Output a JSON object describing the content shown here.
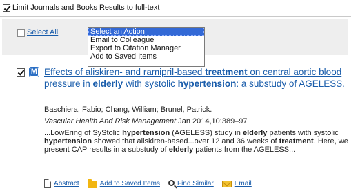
{
  "filters": {
    "limit_fulltext_label": "Limit Journals and Books Results to full-text",
    "limit_fulltext_checked": true
  },
  "toolbar": {
    "select_all_label": "Select All",
    "action_options": [
      "Select an Action",
      "Email to Colleague",
      "Export to Citation Manager",
      "Add to Saved Items"
    ],
    "selected_action": "Select an Action"
  },
  "result": {
    "checked": true,
    "badge": "M",
    "title_parts": [
      {
        "text": "Effects of aliskiren- and ramipril-based ",
        "bold": false
      },
      {
        "text": "treatment",
        "bold": true
      },
      {
        "text": " on central aortic blood pressure in ",
        "bold": false
      },
      {
        "text": "elderly",
        "bold": true
      },
      {
        "text": " with systolic ",
        "bold": false
      },
      {
        "text": "hypertension",
        "bold": true
      },
      {
        "text": ": a substudy of AGELESS.",
        "bold": false
      }
    ],
    "authors": "Baschiera, Fabio; Chang, William; Brunel, Patrick.",
    "journal": "Vascular Health And Risk Management",
    "citation": " Jan 2014,10:389–97",
    "abstract_parts": [
      {
        "text": "...LowEring of SyStolic ",
        "bold": false
      },
      {
        "text": "hypertension",
        "bold": true
      },
      {
        "text": " (AGELESS) study in ",
        "bold": false
      },
      {
        "text": "elderly",
        "bold": true
      },
      {
        "text": " patients with systolic ",
        "bold": false
      },
      {
        "text": "hypertension",
        "bold": true
      },
      {
        "text": " showed that aliskiren-based...over 12 and 36 weeks of ",
        "bold": false
      },
      {
        "text": "treatment",
        "bold": true
      },
      {
        "text": ". Here, we present CAP results in a substudy of ",
        "bold": false
      },
      {
        "text": "elderly",
        "bold": true
      },
      {
        "text": " patients from the AGELESS...",
        "bold": false
      }
    ],
    "links": {
      "abstract": "Abstract",
      "save": "Add to Saved Items",
      "similar": "Find Similar",
      "email": "Email"
    },
    "link_icons": [
      "document-icon",
      "folder-icon",
      "search-icon",
      "mail-icon"
    ]
  },
  "colors": {
    "link": "#1a5dab",
    "selected_option": "#3369d6",
    "toolbar_bg": "#eeeeee",
    "badge": "#2b6fc4"
  }
}
